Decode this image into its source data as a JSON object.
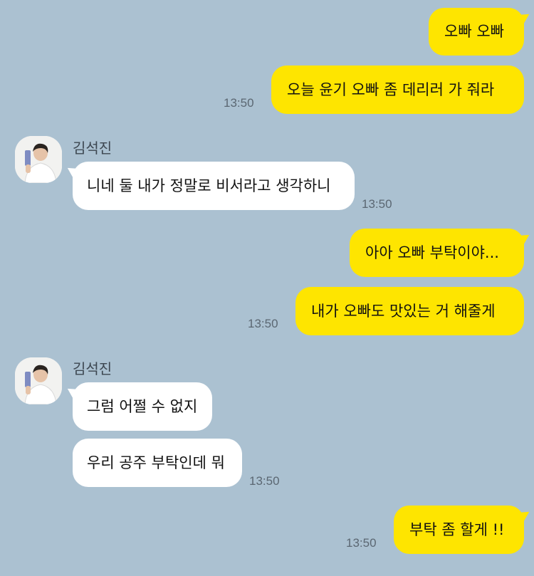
{
  "contact": {
    "name": "김석진",
    "avatar_icon": "profile-photo"
  },
  "colors": {
    "background": "#abc1d1",
    "my_bubble": "#fee500",
    "their_bubble": "#ffffff"
  },
  "messages": [
    {
      "sender": "me",
      "text": "오빠 오빠"
    },
    {
      "sender": "me",
      "text": "오늘 윤기 오빠 좀 데리러 가 줘라",
      "time": "13:50"
    },
    {
      "sender": "them",
      "text": "니네 둘 내가 정말로 비서라고 생각하니",
      "time": "13:50"
    },
    {
      "sender": "me",
      "text": "아아 오빠 부탁이야..."
    },
    {
      "sender": "me",
      "text": "내가 오빠도 맛있는 거 해줄게",
      "time": "13:50"
    },
    {
      "sender": "them",
      "text": "그럼 어쩔 수 없지"
    },
    {
      "sender": "them",
      "text": "우리 공주 부탁인데 뭐",
      "time": "13:50"
    },
    {
      "sender": "me",
      "text": "부탁 좀 할게 !!",
      "time": "13:50"
    }
  ]
}
